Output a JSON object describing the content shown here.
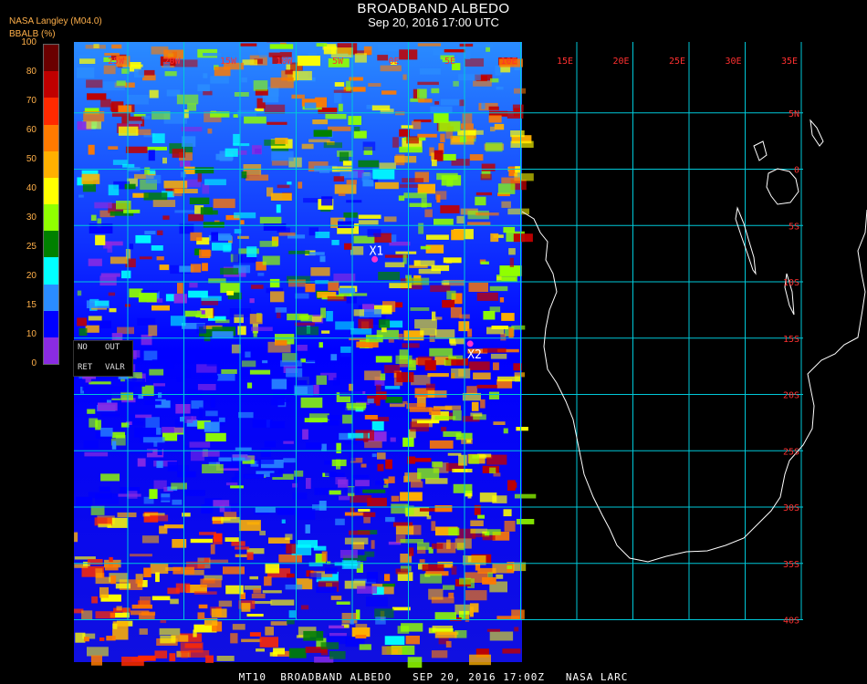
{
  "header": {
    "title": "BROADBAND ALBEDO",
    "subtitle": "Sep 20, 2016 17:00 UTC",
    "organization": "NASA Langley (M04.0)",
    "units_label": "BBALB (%)"
  },
  "legend": {
    "ticks": [
      "100",
      "80",
      "70",
      "60",
      "50",
      "40",
      "30",
      "25",
      "20",
      "15",
      "10",
      "0"
    ],
    "colors": [
      "#6a0000",
      "#c00000",
      "#ff2a00",
      "#ff7a00",
      "#ffb000",
      "#ffff00",
      "#90ff00",
      "#008000",
      "#00ffff",
      "#2a8cff",
      "#0000ff",
      "#8a2be2"
    ]
  },
  "no_data_box": {
    "no": "NO",
    "out": "OUT",
    "ret": "RET",
    "valr": "VALR"
  },
  "markers": [
    {
      "label": "X1",
      "lon": -3,
      "lat": -8,
      "color": "#ff33cc"
    },
    {
      "label": "X2",
      "lon": 5.5,
      "lat": -15.5,
      "color": "#ff33cc"
    }
  ],
  "grid": {
    "lon_labels": [
      "25W",
      "20W",
      "15W",
      "10W",
      "5W",
      "0E",
      "5E",
      "10E",
      "15E",
      "20E",
      "25E",
      "30E",
      "35E"
    ],
    "lat_labels": [
      "5N",
      "0",
      "5S",
      "10S",
      "15S",
      "20S",
      "25S",
      "30S",
      "35S",
      "40S"
    ],
    "lon_range": [
      -25,
      35
    ],
    "lat_range": [
      10,
      -40
    ],
    "line_color": "#00c8d8",
    "label_color": "#ff3030"
  },
  "footer": "MT10  BROADBAND ALBEDO   SEP 20, 2016 17:00Z   NASA LARC"
}
